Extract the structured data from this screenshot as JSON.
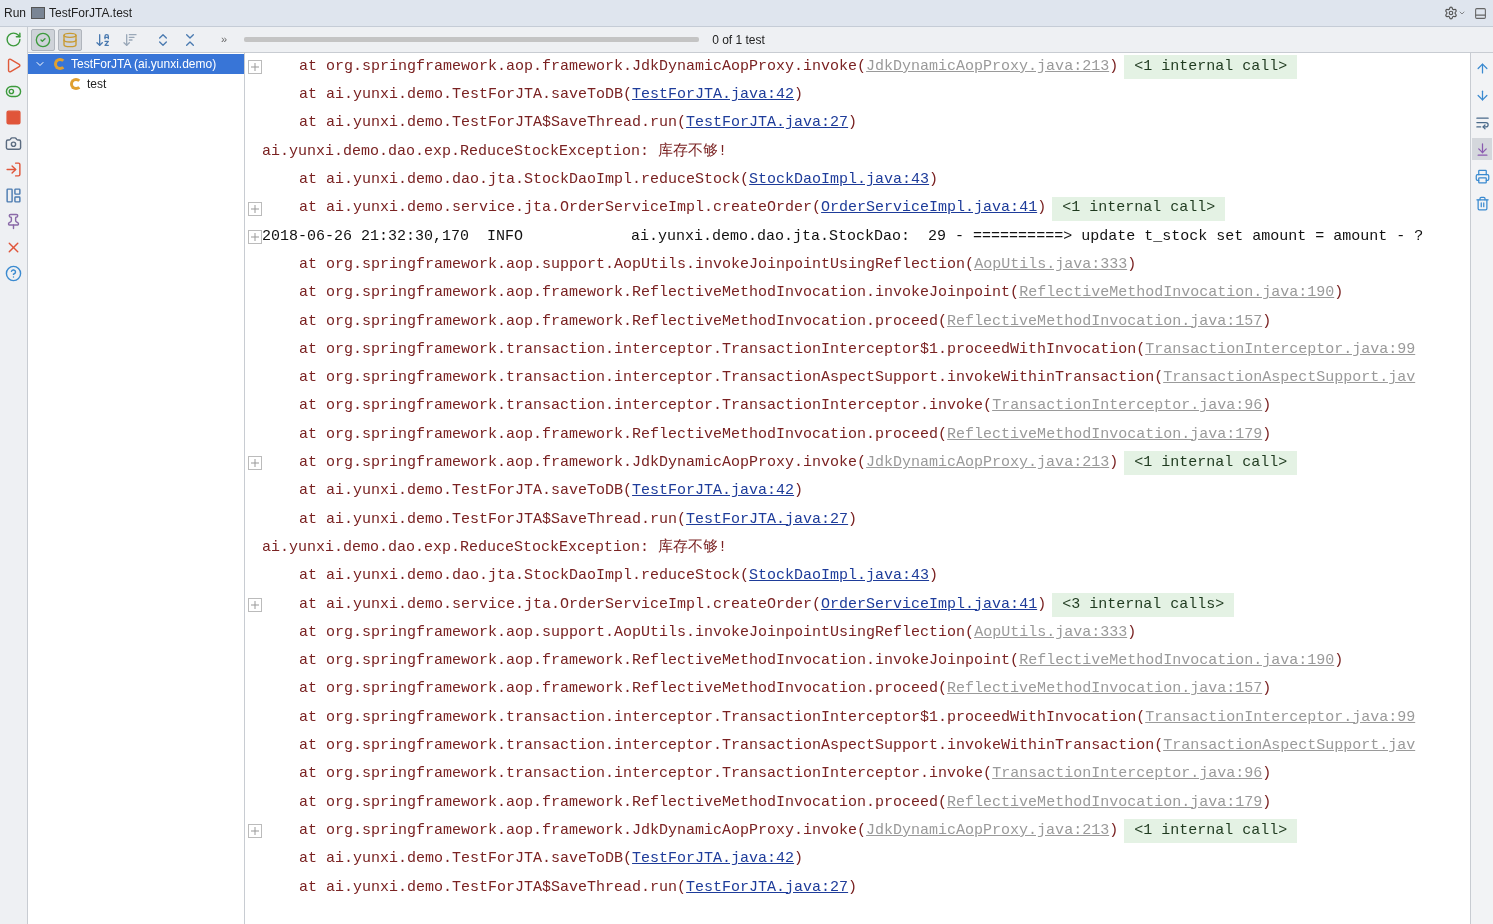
{
  "title_bar": {
    "tab_label": "Run",
    "config": "TestForJTA.test"
  },
  "side_tools": [
    {
      "kind": "rerun"
    },
    {
      "kind": "rerun_failed"
    },
    {
      "kind": "toggle"
    },
    {
      "kind": "stop"
    },
    {
      "kind": "camera"
    },
    {
      "kind": "exit"
    },
    {
      "kind": "layout"
    },
    {
      "kind": "pin"
    },
    {
      "kind": "close"
    },
    {
      "kind": "help"
    }
  ],
  "toolbar": {
    "buttons": [
      {
        "kind": "passed",
        "selected": true
      },
      {
        "kind": "ignored",
        "selected": true
      },
      {
        "kind": "sort_alpha",
        "selected": false
      },
      {
        "kind": "sort_duration",
        "selected": false
      },
      {
        "kind": "expand",
        "selected": false
      },
      {
        "kind": "collapse",
        "selected": false
      }
    ],
    "more": "»",
    "progress": {
      "level": 1
    },
    "status": "0 of 1 test"
  },
  "tree": [
    {
      "label": "TestForJTA (ai.yunxi.demo)",
      "selected": true,
      "expanded": true,
      "children": [
        {
          "label": "test",
          "selected": false
        }
      ]
    }
  ],
  "right_tools": [
    {
      "kind": "up",
      "selected": false
    },
    {
      "kind": "down",
      "selected": false
    },
    {
      "kind": "wrap",
      "selected": false
    },
    {
      "kind": "scroll_end",
      "selected": true
    },
    {
      "kind": "print",
      "selected": false
    },
    {
      "kind": "clear",
      "selected": false
    }
  ],
  "console": [
    {
      "kind": "frame",
      "fold": true,
      "text": "at org.springframework.aop.framework.JdkDynamicAopProxy.invoke(",
      "link": "JdkDynamicAopProxy.java:213",
      "library": true,
      "close": ")",
      "badge": "<1 internal call>"
    },
    {
      "kind": "frame",
      "fold": false,
      "text": "at ai.yunxi.demo.TestForJTA.saveToDB(",
      "link": "TestForJTA.java:42",
      "library": false,
      "close": ")"
    },
    {
      "kind": "frame",
      "fold": false,
      "text": "at ai.yunxi.demo.TestForJTA$SaveThread.run(",
      "link": "TestForJTA.java:27",
      "library": false,
      "close": ")"
    },
    {
      "kind": "exception",
      "fold": false,
      "text": "ai.yunxi.demo.dao.exp.ReduceStockException: 库存不够!"
    },
    {
      "kind": "frame",
      "fold": false,
      "text": "at ai.yunxi.demo.dao.jta.StockDaoImpl.reduceStock(",
      "link": "StockDaoImpl.java:43",
      "library": false,
      "close": ")"
    },
    {
      "kind": "frame",
      "fold": true,
      "text": "at ai.yunxi.demo.service.jta.OrderServiceImpl.createOrder(",
      "link": "OrderServiceImpl.java:41",
      "library": false,
      "close": ")",
      "badge": "<1 internal call>"
    },
    {
      "kind": "log",
      "fold": true,
      "text": "2018-06-26 21:32:30,170  INFO            ai.yunxi.demo.dao.jta.StockDao:  29 - ==========> update t_stock set amount = amount - ?"
    },
    {
      "kind": "frame",
      "fold": false,
      "text": "at org.springframework.aop.support.AopUtils.invokeJoinpointUsingReflection(",
      "link": "AopUtils.java:333",
      "library": true,
      "close": ")"
    },
    {
      "kind": "frame",
      "fold": false,
      "text": "at org.springframework.aop.framework.ReflectiveMethodInvocation.invokeJoinpoint(",
      "link": "ReflectiveMethodInvocation.java:190",
      "library": true,
      "close": ")"
    },
    {
      "kind": "frame",
      "fold": false,
      "text": "at org.springframework.aop.framework.ReflectiveMethodInvocation.proceed(",
      "link": "ReflectiveMethodInvocation.java:157",
      "library": true,
      "close": ")"
    },
    {
      "kind": "frame",
      "fold": false,
      "text": "at org.springframework.transaction.interceptor.TransactionInterceptor$1.proceedWithInvocation(",
      "link": "TransactionInterceptor.java:99",
      "library": true
    },
    {
      "kind": "frame",
      "fold": false,
      "text": "at org.springframework.transaction.interceptor.TransactionAspectSupport.invokeWithinTransaction(",
      "link": "TransactionAspectSupport.jav",
      "library": true
    },
    {
      "kind": "frame",
      "fold": false,
      "text": "at org.springframework.transaction.interceptor.TransactionInterceptor.invoke(",
      "link": "TransactionInterceptor.java:96",
      "library": true,
      "close": ")"
    },
    {
      "kind": "frame",
      "fold": false,
      "text": "at org.springframework.aop.framework.ReflectiveMethodInvocation.proceed(",
      "link": "ReflectiveMethodInvocation.java:179",
      "library": true,
      "close": ")"
    },
    {
      "kind": "frame",
      "fold": true,
      "text": "at org.springframework.aop.framework.JdkDynamicAopProxy.invoke(",
      "link": "JdkDynamicAopProxy.java:213",
      "library": true,
      "close": ")",
      "badge": "<1 internal call>"
    },
    {
      "kind": "frame",
      "fold": false,
      "text": "at ai.yunxi.demo.TestForJTA.saveToDB(",
      "link": "TestForJTA.java:42",
      "library": false,
      "close": ")"
    },
    {
      "kind": "frame",
      "fold": false,
      "text": "at ai.yunxi.demo.TestForJTA$SaveThread.run(",
      "link": "TestForJTA.java:27",
      "library": false,
      "close": ")"
    },
    {
      "kind": "exception",
      "fold": false,
      "text": "ai.yunxi.demo.dao.exp.ReduceStockException: 库存不够!"
    },
    {
      "kind": "frame",
      "fold": false,
      "text": "at ai.yunxi.demo.dao.jta.StockDaoImpl.reduceStock(",
      "link": "StockDaoImpl.java:43",
      "library": false,
      "close": ")"
    },
    {
      "kind": "frame",
      "fold": true,
      "text": "at ai.yunxi.demo.service.jta.OrderServiceImpl.createOrder(",
      "link": "OrderServiceImpl.java:41",
      "library": false,
      "close": ")",
      "badge": "<3 internal calls>"
    },
    {
      "kind": "frame",
      "fold": false,
      "text": "at org.springframework.aop.support.AopUtils.invokeJoinpointUsingReflection(",
      "link": "AopUtils.java:333",
      "library": true,
      "close": ")"
    },
    {
      "kind": "frame",
      "fold": false,
      "text": "at org.springframework.aop.framework.ReflectiveMethodInvocation.invokeJoinpoint(",
      "link": "ReflectiveMethodInvocation.java:190",
      "library": true,
      "close": ")"
    },
    {
      "kind": "frame",
      "fold": false,
      "text": "at org.springframework.aop.framework.ReflectiveMethodInvocation.proceed(",
      "link": "ReflectiveMethodInvocation.java:157",
      "library": true,
      "close": ")"
    },
    {
      "kind": "frame",
      "fold": false,
      "text": "at org.springframework.transaction.interceptor.TransactionInterceptor$1.proceedWithInvocation(",
      "link": "TransactionInterceptor.java:99",
      "library": true
    },
    {
      "kind": "frame",
      "fold": false,
      "text": "at org.springframework.transaction.interceptor.TransactionAspectSupport.invokeWithinTransaction(",
      "link": "TransactionAspectSupport.jav",
      "library": true
    },
    {
      "kind": "frame",
      "fold": false,
      "text": "at org.springframework.transaction.interceptor.TransactionInterceptor.invoke(",
      "link": "TransactionInterceptor.java:96",
      "library": true,
      "close": ")"
    },
    {
      "kind": "frame",
      "fold": false,
      "text": "at org.springframework.aop.framework.ReflectiveMethodInvocation.proceed(",
      "link": "ReflectiveMethodInvocation.java:179",
      "library": true,
      "close": ")"
    },
    {
      "kind": "frame",
      "fold": true,
      "text": "at org.springframework.aop.framework.JdkDynamicAopProxy.invoke(",
      "link": "JdkDynamicAopProxy.java:213",
      "library": true,
      "close": ")",
      "badge": "<1 internal call>"
    },
    {
      "kind": "frame",
      "fold": false,
      "text": "at ai.yunxi.demo.TestForJTA.saveToDB(",
      "link": "TestForJTA.java:42",
      "library": false,
      "close": ")"
    },
    {
      "kind": "frame",
      "fold": false,
      "text": "at ai.yunxi.demo.TestForJTA$SaveThread.run(",
      "link": "TestForJTA.java:27",
      "library": false,
      "close": ")"
    }
  ]
}
